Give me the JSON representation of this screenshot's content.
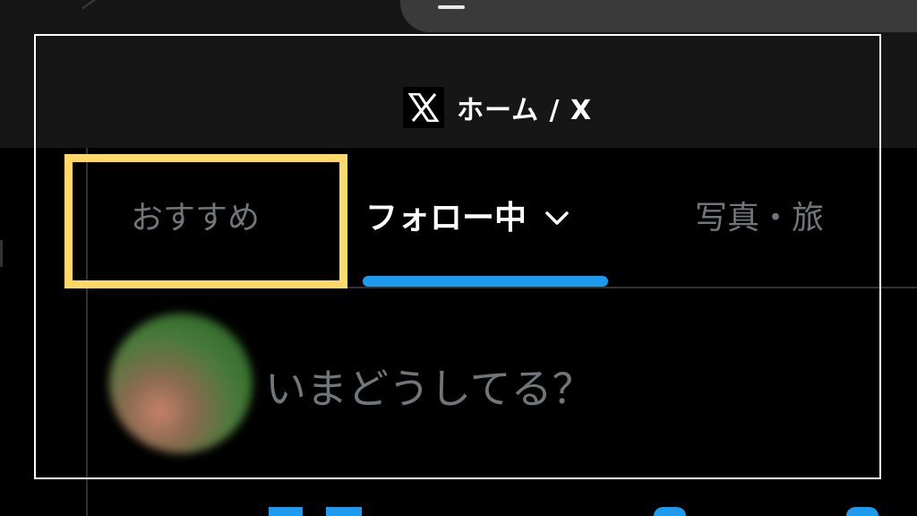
{
  "browser": {
    "title": "ホーム / X",
    "logo_icon": "x-logo-icon"
  },
  "tabs": [
    {
      "label": "おすすめ",
      "active": false
    },
    {
      "label": "フォロー中",
      "active": true,
      "icon": "chevron-down-icon"
    },
    {
      "label": "写真・旅",
      "active": false
    }
  ],
  "compose": {
    "placeholder": "いまどうしてる？",
    "avatar_icon": "avatar"
  },
  "colors": {
    "background": "#000000",
    "chrome": "#161616",
    "accent": "#1d9bf0",
    "muted_text": "#71767b",
    "highlight": "#ffd966"
  }
}
